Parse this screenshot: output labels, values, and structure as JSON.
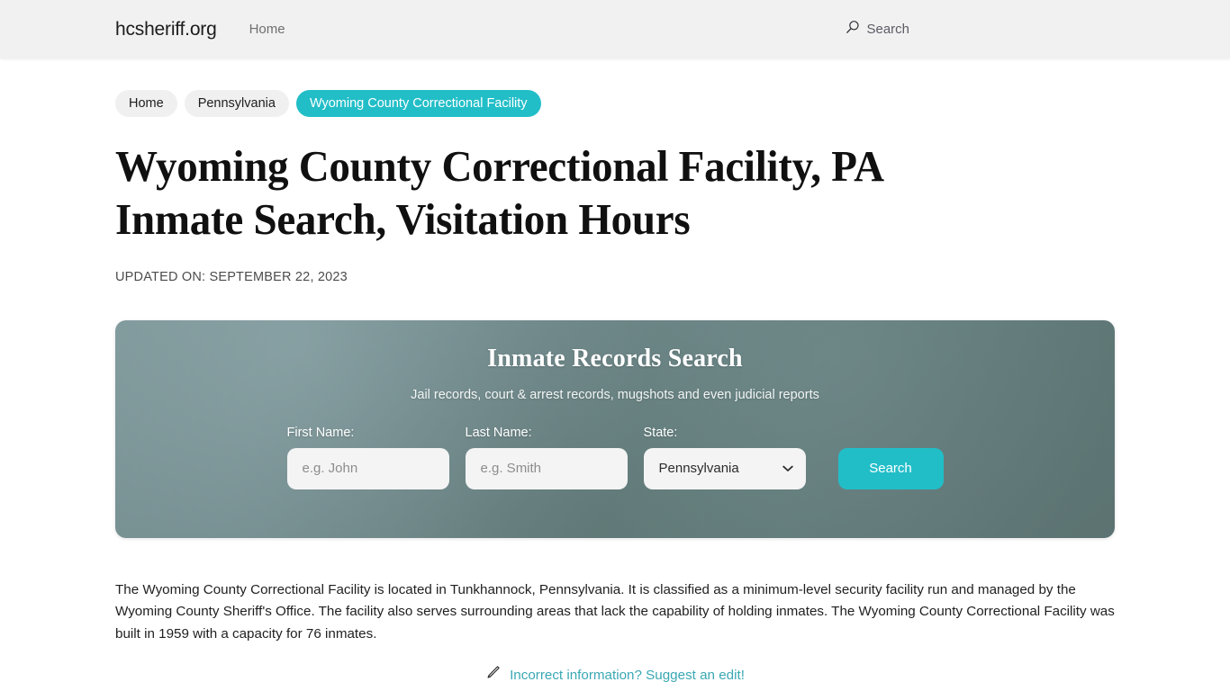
{
  "header": {
    "brand": "hcsheriff.org",
    "nav": [
      {
        "label": "Home",
        "name": "nav-item-home"
      }
    ],
    "search": {
      "label": "Search",
      "icon": "search-icon"
    }
  },
  "breadcrumb": [
    {
      "label": "Home",
      "active": false
    },
    {
      "label": "Pennsylvania",
      "active": false
    },
    {
      "label": "Wyoming County Correctional Facility",
      "active": true
    }
  ],
  "main": {
    "title": "Wyoming County Correctional Facility, PA Inmate Search, Visitation Hours",
    "updated_on": "UPDATED ON: SEPTEMBER 22, 2023",
    "paragraph": "The Wyoming County Correctional Facility is located in Tunkhannock, Pennsylvania. It is classified as a minimum-level security facility run and managed by the Wyoming County Sheriff's Office. The facility also serves surrounding areas that lack the capability of holding inmates. The Wyoming County Correctional Facility was built in 1959 with a capacity for 76 inmates.",
    "suggest_edit": {
      "label": "Incorrect information? Suggest an edit!",
      "icon": "pencil-icon"
    }
  },
  "search_panel": {
    "title": "Inmate Records Search",
    "subtitle": "Jail records, court & arrest records, mugshots and even judicial reports",
    "fields": {
      "first_name": {
        "label": "First Name:",
        "placeholder": "e.g. John",
        "value": ""
      },
      "last_name": {
        "label": "Last Name:",
        "placeholder": "e.g. Smith",
        "value": ""
      },
      "state": {
        "label": "State:",
        "selected": "Pennsylvania",
        "options": [
          "Pennsylvania"
        ]
      }
    },
    "submit_label": "Search"
  },
  "colors": {
    "accent_teal": "#22bec8",
    "link_teal": "#3aa8b4",
    "header_bg": "#f1f1f1",
    "crumb_bg": "#f0f0f0",
    "panel_bg": "#6d8688",
    "page_bg": "#ffffff"
  }
}
